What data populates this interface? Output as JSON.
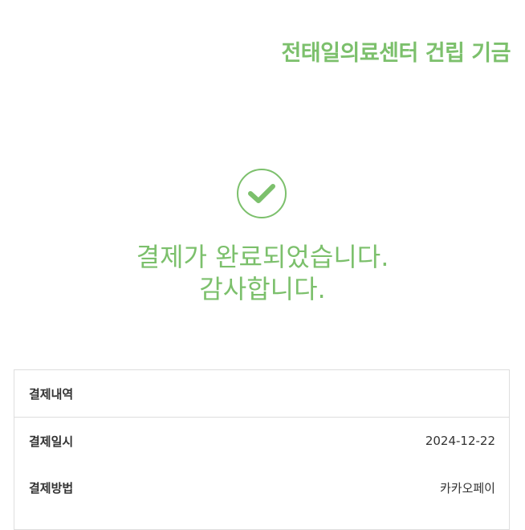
{
  "header": {
    "title": "전태일의료센터 건립 기금"
  },
  "status": {
    "icon": "check-circle-icon",
    "line1": "결제가 완료되었습니다.",
    "line2": "감사합니다."
  },
  "details": {
    "heading": "결제내역",
    "rows": [
      {
        "label": "결제일시",
        "value": "2024-12-22"
      },
      {
        "label": "결제방법",
        "value": "카카오페이"
      }
    ]
  },
  "colors": {
    "accent": "#7cc06c",
    "border": "#dedede",
    "text": "#333333"
  }
}
